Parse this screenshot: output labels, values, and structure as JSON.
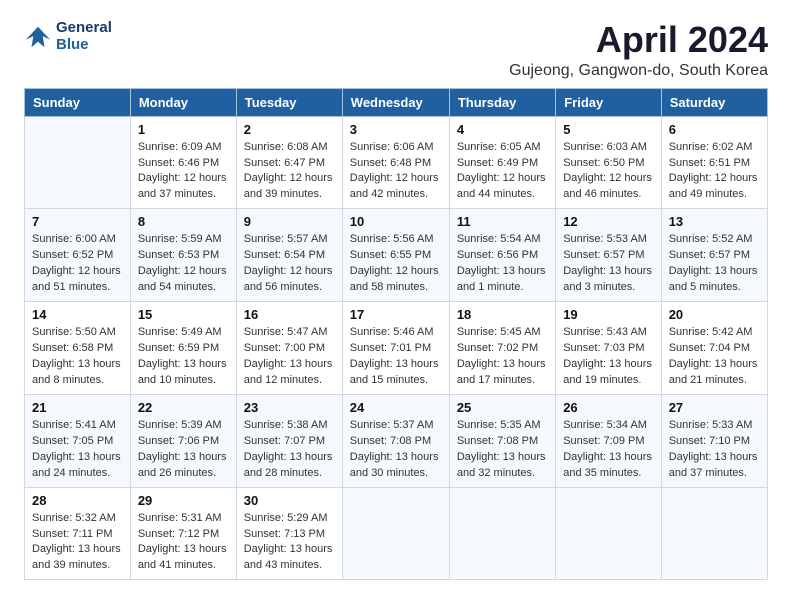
{
  "logo": {
    "line1": "General",
    "line2": "Blue"
  },
  "title": "April 2024",
  "location": "Gujeong, Gangwon-do, South Korea",
  "weekdays": [
    "Sunday",
    "Monday",
    "Tuesday",
    "Wednesday",
    "Thursday",
    "Friday",
    "Saturday"
  ],
  "weeks": [
    [
      {
        "day": "",
        "info": ""
      },
      {
        "day": "1",
        "info": "Sunrise: 6:09 AM\nSunset: 6:46 PM\nDaylight: 12 hours\nand 37 minutes."
      },
      {
        "day": "2",
        "info": "Sunrise: 6:08 AM\nSunset: 6:47 PM\nDaylight: 12 hours\nand 39 minutes."
      },
      {
        "day": "3",
        "info": "Sunrise: 6:06 AM\nSunset: 6:48 PM\nDaylight: 12 hours\nand 42 minutes."
      },
      {
        "day": "4",
        "info": "Sunrise: 6:05 AM\nSunset: 6:49 PM\nDaylight: 12 hours\nand 44 minutes."
      },
      {
        "day": "5",
        "info": "Sunrise: 6:03 AM\nSunset: 6:50 PM\nDaylight: 12 hours\nand 46 minutes."
      },
      {
        "day": "6",
        "info": "Sunrise: 6:02 AM\nSunset: 6:51 PM\nDaylight: 12 hours\nand 49 minutes."
      }
    ],
    [
      {
        "day": "7",
        "info": "Sunrise: 6:00 AM\nSunset: 6:52 PM\nDaylight: 12 hours\nand 51 minutes."
      },
      {
        "day": "8",
        "info": "Sunrise: 5:59 AM\nSunset: 6:53 PM\nDaylight: 12 hours\nand 54 minutes."
      },
      {
        "day": "9",
        "info": "Sunrise: 5:57 AM\nSunset: 6:54 PM\nDaylight: 12 hours\nand 56 minutes."
      },
      {
        "day": "10",
        "info": "Sunrise: 5:56 AM\nSunset: 6:55 PM\nDaylight: 12 hours\nand 58 minutes."
      },
      {
        "day": "11",
        "info": "Sunrise: 5:54 AM\nSunset: 6:56 PM\nDaylight: 13 hours\nand 1 minute."
      },
      {
        "day": "12",
        "info": "Sunrise: 5:53 AM\nSunset: 6:57 PM\nDaylight: 13 hours\nand 3 minutes."
      },
      {
        "day": "13",
        "info": "Sunrise: 5:52 AM\nSunset: 6:57 PM\nDaylight: 13 hours\nand 5 minutes."
      }
    ],
    [
      {
        "day": "14",
        "info": "Sunrise: 5:50 AM\nSunset: 6:58 PM\nDaylight: 13 hours\nand 8 minutes."
      },
      {
        "day": "15",
        "info": "Sunrise: 5:49 AM\nSunset: 6:59 PM\nDaylight: 13 hours\nand 10 minutes."
      },
      {
        "day": "16",
        "info": "Sunrise: 5:47 AM\nSunset: 7:00 PM\nDaylight: 13 hours\nand 12 minutes."
      },
      {
        "day": "17",
        "info": "Sunrise: 5:46 AM\nSunset: 7:01 PM\nDaylight: 13 hours\nand 15 minutes."
      },
      {
        "day": "18",
        "info": "Sunrise: 5:45 AM\nSunset: 7:02 PM\nDaylight: 13 hours\nand 17 minutes."
      },
      {
        "day": "19",
        "info": "Sunrise: 5:43 AM\nSunset: 7:03 PM\nDaylight: 13 hours\nand 19 minutes."
      },
      {
        "day": "20",
        "info": "Sunrise: 5:42 AM\nSunset: 7:04 PM\nDaylight: 13 hours\nand 21 minutes."
      }
    ],
    [
      {
        "day": "21",
        "info": "Sunrise: 5:41 AM\nSunset: 7:05 PM\nDaylight: 13 hours\nand 24 minutes."
      },
      {
        "day": "22",
        "info": "Sunrise: 5:39 AM\nSunset: 7:06 PM\nDaylight: 13 hours\nand 26 minutes."
      },
      {
        "day": "23",
        "info": "Sunrise: 5:38 AM\nSunset: 7:07 PM\nDaylight: 13 hours\nand 28 minutes."
      },
      {
        "day": "24",
        "info": "Sunrise: 5:37 AM\nSunset: 7:08 PM\nDaylight: 13 hours\nand 30 minutes."
      },
      {
        "day": "25",
        "info": "Sunrise: 5:35 AM\nSunset: 7:08 PM\nDaylight: 13 hours\nand 32 minutes."
      },
      {
        "day": "26",
        "info": "Sunrise: 5:34 AM\nSunset: 7:09 PM\nDaylight: 13 hours\nand 35 minutes."
      },
      {
        "day": "27",
        "info": "Sunrise: 5:33 AM\nSunset: 7:10 PM\nDaylight: 13 hours\nand 37 minutes."
      }
    ],
    [
      {
        "day": "28",
        "info": "Sunrise: 5:32 AM\nSunset: 7:11 PM\nDaylight: 13 hours\nand 39 minutes."
      },
      {
        "day": "29",
        "info": "Sunrise: 5:31 AM\nSunset: 7:12 PM\nDaylight: 13 hours\nand 41 minutes."
      },
      {
        "day": "30",
        "info": "Sunrise: 5:29 AM\nSunset: 7:13 PM\nDaylight: 13 hours\nand 43 minutes."
      },
      {
        "day": "",
        "info": ""
      },
      {
        "day": "",
        "info": ""
      },
      {
        "day": "",
        "info": ""
      },
      {
        "day": "",
        "info": ""
      }
    ]
  ]
}
